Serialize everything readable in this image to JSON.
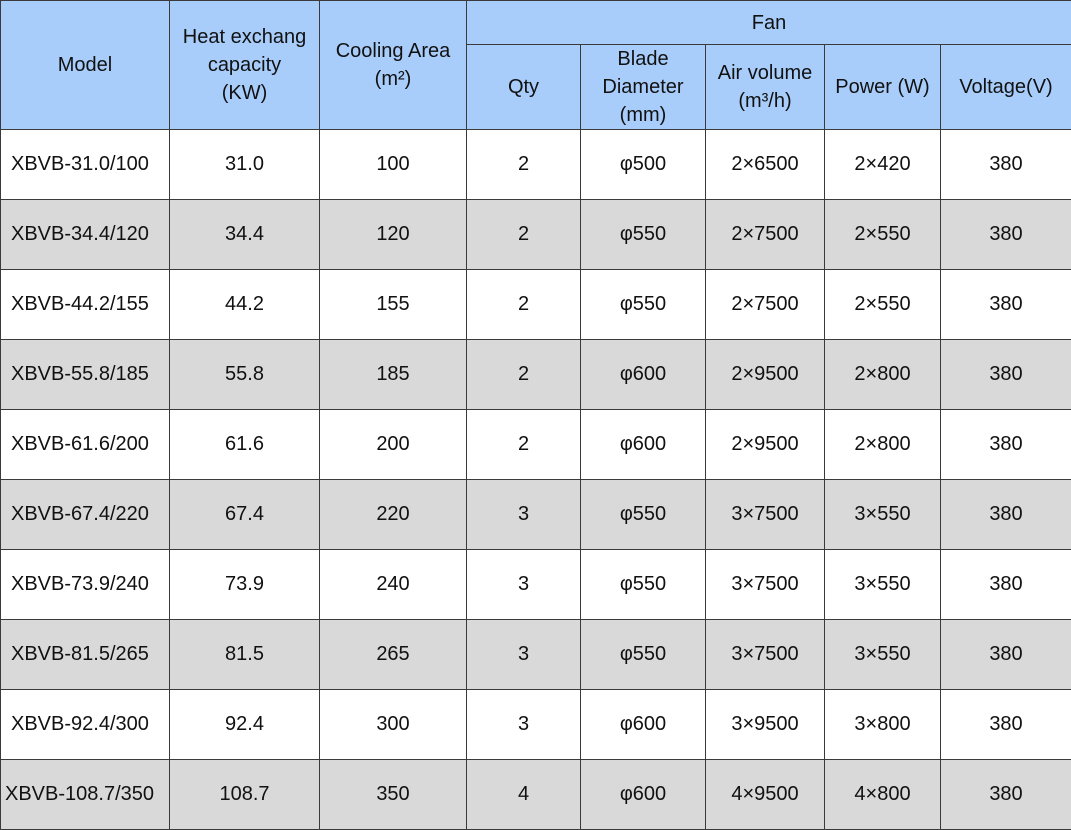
{
  "headers": {
    "model": "Model",
    "heat_line1": "Heat exchang",
    "heat_line2": "capacity",
    "heat_line3": "(KW)",
    "cooling_line1": "Cooling Area",
    "cooling_line2": "(m²)",
    "fan": "Fan",
    "qty": "Qty",
    "blade_line1": "Blade",
    "blade_line2": "Diameter",
    "blade_line3": "(mm)",
    "air_line1": "Air volume",
    "air_line2": "(m³/h)",
    "power": "Power (W)",
    "voltage": "Voltage(V)"
  },
  "rows": [
    {
      "model": "XBVB-31.0/100",
      "heat": "31.0",
      "area": "100",
      "qty": "2",
      "blade": "φ500",
      "air": "2×6500",
      "power": "2×420",
      "voltage": "380"
    },
    {
      "model": "XBVB-34.4/120",
      "heat": "34.4",
      "area": "120",
      "qty": "2",
      "blade": "φ550",
      "air": "2×7500",
      "power": "2×550",
      "voltage": "380"
    },
    {
      "model": "XBVB-44.2/155",
      "heat": "44.2",
      "area": "155",
      "qty": "2",
      "blade": "φ550",
      "air": "2×7500",
      "power": "2×550",
      "voltage": "380"
    },
    {
      "model": "XBVB-55.8/185",
      "heat": "55.8",
      "area": "185",
      "qty": "2",
      "blade": "φ600",
      "air": "2×9500",
      "power": "2×800",
      "voltage": "380"
    },
    {
      "model": "XBVB-61.6/200",
      "heat": "61.6",
      "area": "200",
      "qty": "2",
      "blade": "φ600",
      "air": "2×9500",
      "power": "2×800",
      "voltage": "380"
    },
    {
      "model": "XBVB-67.4/220",
      "heat": "67.4",
      "area": "220",
      "qty": "3",
      "blade": "φ550",
      "air": "3×7500",
      "power": "3×550",
      "voltage": "380"
    },
    {
      "model": "XBVB-73.9/240",
      "heat": "73.9",
      "area": "240",
      "qty": "3",
      "blade": "φ550",
      "air": "3×7500",
      "power": "3×550",
      "voltage": "380"
    },
    {
      "model": "XBVB-81.5/265",
      "heat": "81.5",
      "area": "265",
      "qty": "3",
      "blade": "φ550",
      "air": "3×7500",
      "power": "3×550",
      "voltage": "380"
    },
    {
      "model": "XBVB-92.4/300",
      "heat": "92.4",
      "area": "300",
      "qty": "3",
      "blade": "φ600",
      "air": "3×9500",
      "power": "3×800",
      "voltage": "380"
    },
    {
      "model": "XBVB-108.7/350",
      "heat": "108.7",
      "area": "350",
      "qty": "4",
      "blade": "φ600",
      "air": "4×9500",
      "power": "4×800",
      "voltage": "380"
    }
  ],
  "colors": {
    "header_bg": "#a8cdfb",
    "row_shade": "#d9d9d9",
    "row_plain": "#ffffff",
    "border": "#3a3a3a"
  }
}
